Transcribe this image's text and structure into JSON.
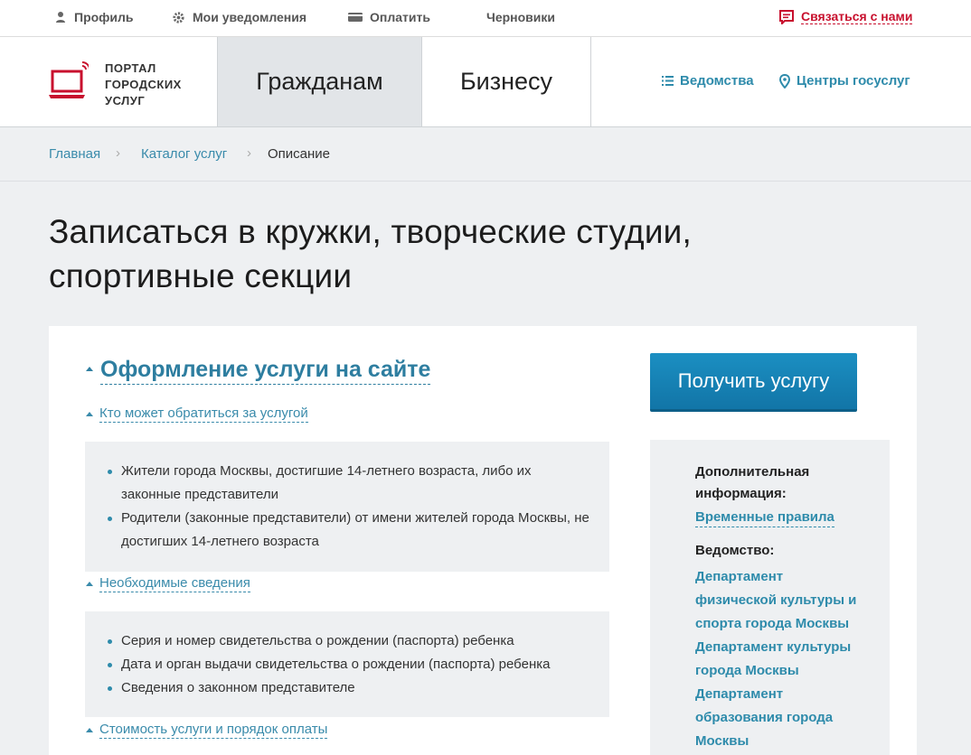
{
  "topbar": {
    "profile": "Профиль",
    "notifications": "Мои уведомления",
    "pay": "Оплатить",
    "drafts": "Черновики",
    "contact": "Связаться с нами"
  },
  "header": {
    "logo_line1": "ПОРТАЛ",
    "logo_line2": "ГОРОДСКИХ",
    "logo_line3": "УСЛУГ",
    "tab_citizens": "Гражданам",
    "tab_business": "Бизнесу",
    "link_departments": "Ведомства",
    "link_centers": "Центры госуслуг"
  },
  "breadcrumb": {
    "home": "Главная",
    "catalog": "Каталог услуг",
    "current": "Описание"
  },
  "page": {
    "title_line1": "Записаться в кружки, творческие студии,",
    "title_line2": "спортивные секции"
  },
  "main": {
    "section_title": "Оформление услуги на сайте",
    "who_toggle": "Кто может обратиться за услугой",
    "who_items": [
      "Жители города Москвы, достигшие 14-летнего возраста, либо их законные представители",
      "Родители (законные представители) от имени жителей города Москвы, не достигших 14-летнего возраста"
    ],
    "info_toggle": "Необходимые сведения",
    "info_items": [
      "Серия и номер свидетельства о рождении (паспорта) ребенка",
      "Дата и орган выдачи свидетельства о рождении (паспорта) ребенка",
      "Сведения о законном представителе"
    ],
    "cost_toggle": "Стоимость услуги и порядок оплаты",
    "cta_label": "Получить услугу"
  },
  "sidebar": {
    "extra_head": "Дополнительная информация:",
    "temp_rules": "Временные правила",
    "dept_head": "Ведомство:",
    "departments": [
      "Департамент физической культуры и спорта города Москвы",
      "Департамент культуры города Москвы",
      "Департамент образования города Москвы"
    ]
  },
  "colors": {
    "accent": "#2e8bab",
    "brand_red": "#c8102e",
    "cta": "#1b8fc2"
  }
}
